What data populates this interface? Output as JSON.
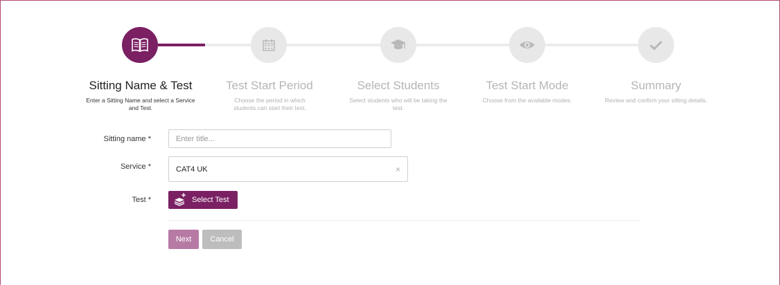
{
  "wizard": {
    "steps": [
      {
        "title": "Sitting Name & Test",
        "description": "Enter a Sitting Name and select a Service and Test.",
        "icon": "open-book-icon",
        "active": true
      },
      {
        "title": "Test Start Period",
        "description": "Choose the period in which students can start their test.",
        "icon": "calendar-icon",
        "active": false
      },
      {
        "title": "Select Students",
        "description": "Select students who will be taking the test.",
        "icon": "graduation-cap-icon",
        "active": false
      },
      {
        "title": "Test Start Mode",
        "description": "Choose from the available modes.",
        "icon": "eye-icon",
        "active": false
      },
      {
        "title": "Summary",
        "description": "Review and confirm your sitting details.",
        "icon": "checkmark-icon",
        "active": false
      }
    ]
  },
  "form": {
    "sitting_name": {
      "label": "Sitting name *",
      "placeholder": "Enter title...",
      "value": ""
    },
    "service": {
      "label": "Service *",
      "value": "CAT4 UK",
      "clear": "×"
    },
    "test": {
      "label": "Test *",
      "button_label": "Select Test",
      "button_icon": "add-layers-icon"
    }
  },
  "actions": {
    "next_label": "Next",
    "cancel_label": "Cancel"
  },
  "colors": {
    "accent": "#7a2063",
    "accent_light": "#b77aa5",
    "inactive": "#e8e8e8",
    "border": "#b44a77"
  }
}
